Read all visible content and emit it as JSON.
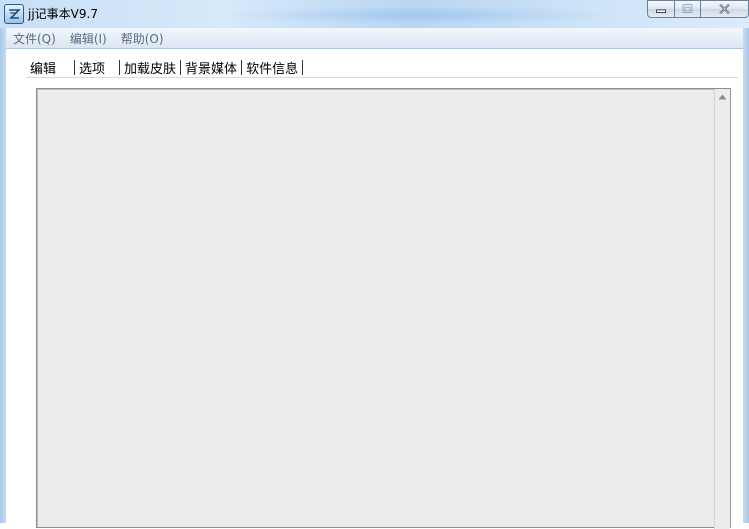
{
  "window": {
    "title": "jj记事本V9.7"
  },
  "menu": {
    "items": [
      "文件(Q)",
      "编辑(I)",
      "帮助(O)"
    ]
  },
  "tabs": {
    "items": [
      "编辑",
      "选项",
      "加载皮肤",
      "背景媒体",
      "软件信息"
    ],
    "active_index": 0
  },
  "icons": {
    "app": "jj-app-icon",
    "minimize": "minimize-icon",
    "maximize": "maximize-icon",
    "close": "close-icon",
    "scroll_up": "scroll-up-arrow-icon"
  },
  "colors": {
    "titlebar": "#c7dff5",
    "menubar": "#dbe6f3",
    "editor_bg": "#ececec",
    "menu_text": "#5a6b80"
  }
}
